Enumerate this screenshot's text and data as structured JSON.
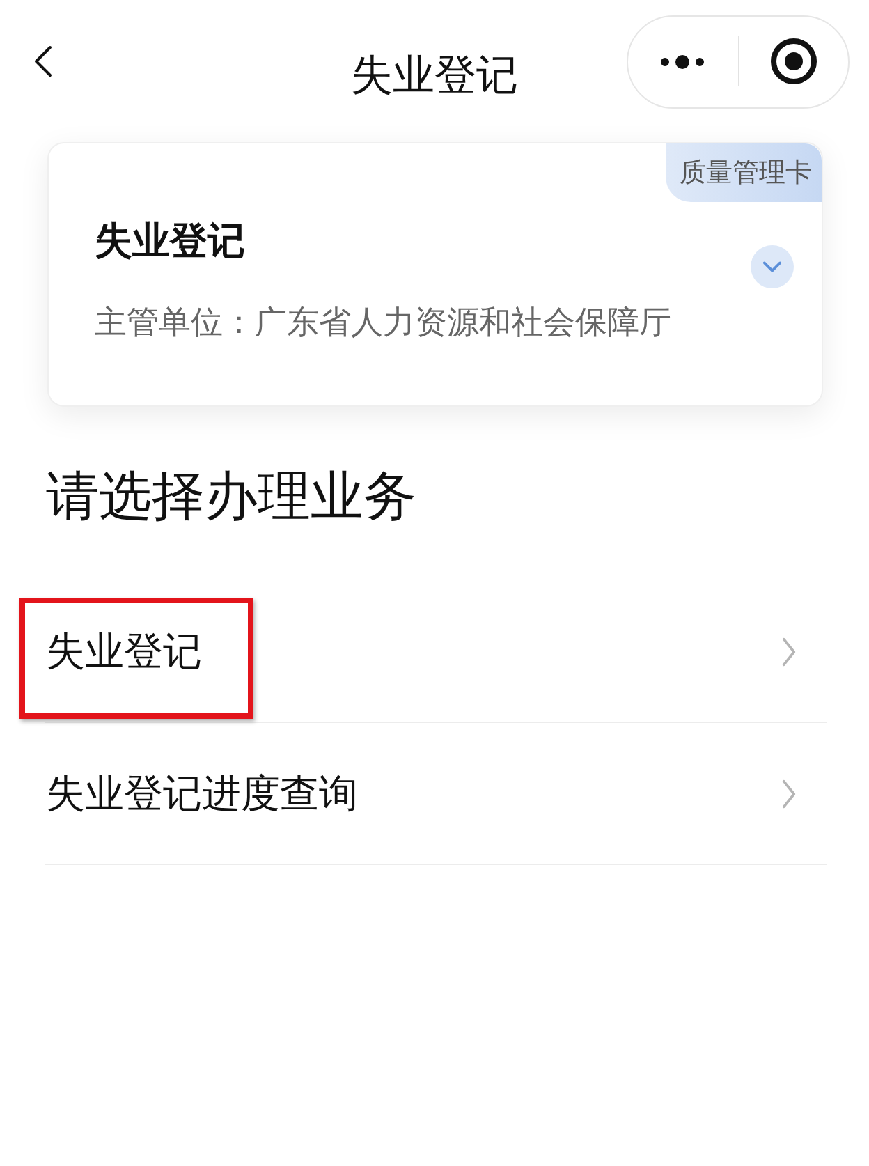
{
  "nav_bar": {
    "title": "失业登记"
  },
  "card": {
    "title": "失业登记",
    "subtitle": "主管单位：广东省人力资源和社会保障厅",
    "tag": "质量管理卡",
    "expanded": false
  },
  "section_title": "请选择办理业务",
  "services": [
    {
      "label": "失业登记",
      "highlighted": true
    },
    {
      "label": "失业登记进度查询",
      "highlighted": false
    }
  ]
}
